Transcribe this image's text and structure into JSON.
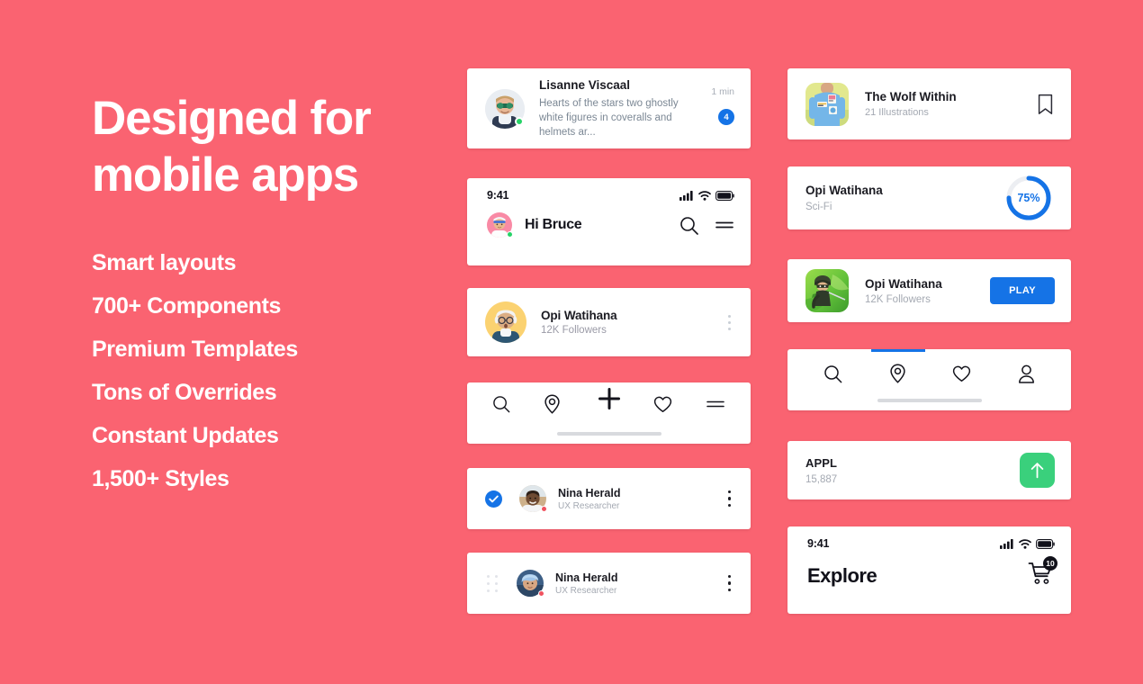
{
  "theme": {
    "background": "#fa6371",
    "accent_blue": "#1573e6",
    "accent_green": "#3ad07c",
    "card": "#ffffff"
  },
  "hero": {
    "title_line1": "Designed for",
    "title_line2": "mobile apps",
    "features": [
      "Smart layouts",
      "700+ Components",
      "Premium Templates",
      "Tons of Overrides",
      "Constant Updates",
      "1,500+ Styles"
    ]
  },
  "message_card": {
    "name": "Lisanne Viscaal",
    "preview": "Hearts of the stars two ghostly white figures in coveralls and helmets ar...",
    "time": "1 min",
    "badge": "4",
    "status": "online"
  },
  "header_card": {
    "status_time": "9:41",
    "greeting": "Hi Bruce",
    "icons": [
      "signal-icon",
      "wifi-icon",
      "battery-icon",
      "search-icon",
      "menu-icon"
    ]
  },
  "profile_card": {
    "name": "Opi Watihana",
    "followers": "12K Followers",
    "menu_icon": "kebab-menu-icon"
  },
  "tabbar_card": {
    "fab_icon": "plus-icon",
    "items": [
      "search-icon",
      "location-pin-icon",
      "heart-icon",
      "menu-icon"
    ]
  },
  "list_rows": [
    {
      "name": "Nina Herald",
      "role": "UX Researcher",
      "leading": "checkbox-checked",
      "menu_icon": "kebab-menu-icon"
    },
    {
      "name": "Nina Herald",
      "role": "UX Researcher",
      "leading": "drag-handle",
      "menu_icon": "kebab-menu-icon"
    }
  ],
  "book_card": {
    "title": "The Wolf Within",
    "subtitle": "21 Illustrations",
    "action_icon": "bookmark-icon"
  },
  "progress_card": {
    "title": "Opi Watihana",
    "subtitle": "Sci-Fi",
    "percent_label": "75%",
    "percent_value": 75
  },
  "game_card": {
    "title": "Opi Watihana",
    "subtitle": "12K Followers",
    "button_label": "PLAY"
  },
  "nav_card": {
    "items": [
      "search-icon",
      "location-pin-icon",
      "heart-icon",
      "user-icon"
    ],
    "active_index": 1
  },
  "stock_card": {
    "symbol": "APPL",
    "value": "15,887",
    "action_icon": "arrow-up-icon"
  },
  "explore_card": {
    "status_time": "9:41",
    "title": "Explore",
    "cart_badge": "10",
    "cart_icon": "shopping-cart-icon"
  }
}
